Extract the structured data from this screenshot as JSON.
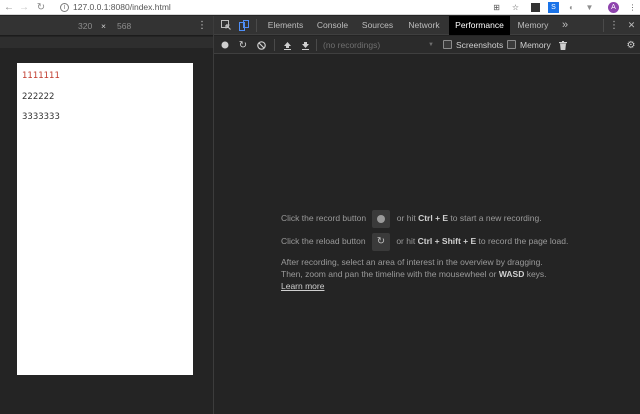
{
  "browser": {
    "url": "127.0.0.1:8080/index.html",
    "icons": [
      "back-icon",
      "forward-icon",
      "reload-icon",
      "info-icon",
      "translate-icon",
      "star-icon",
      "extension-icons",
      "avatar",
      "menu-icon"
    ]
  },
  "device_toolbar": {
    "width": "320",
    "times": "×",
    "height": "568",
    "more": "⋮"
  },
  "page": {
    "lines": [
      {
        "text": "1111111",
        "color": "#c0392b"
      },
      {
        "text": "222222",
        "color": "#333333"
      },
      {
        "text": "3333333",
        "color": "#333333"
      }
    ]
  },
  "devtools": {
    "tabs": [
      {
        "label": "Elements",
        "active": false
      },
      {
        "label": "Console",
        "active": false
      },
      {
        "label": "Sources",
        "active": false
      },
      {
        "label": "Network",
        "active": false
      },
      {
        "label": "Performance",
        "active": true
      },
      {
        "label": "Memory",
        "active": false
      }
    ],
    "more_tabs": "»",
    "menu": "⋮",
    "close": "✕",
    "recordings_placeholder": "(no recordings)",
    "screenshots_label": "Screenshots",
    "memory_label": "Memory"
  },
  "panel": {
    "record_pre": "Click the record button",
    "record_mid": "or hit ",
    "record_key": "Ctrl + E",
    "record_post": " to start a new recording.",
    "reload_pre": "Click the reload button",
    "reload_mid": "or hit ",
    "reload_key": "Ctrl + Shift + E",
    "reload_post": " to record the page load.",
    "after_line1": "After recording, select an area of interest in the overview by dragging.",
    "after_line2_pre": "Then, zoom and pan the timeline with the mousewheel or ",
    "after_line2_key": "WASD",
    "after_line2_post": " keys.",
    "learn_more": "Learn more"
  }
}
